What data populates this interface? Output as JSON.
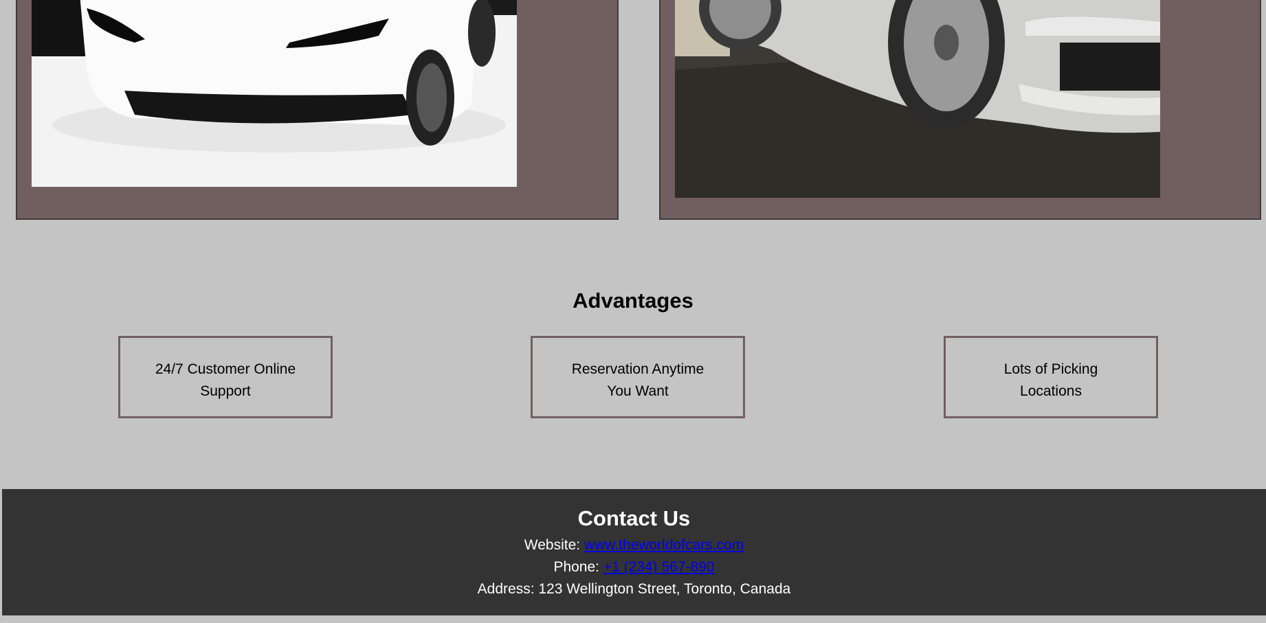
{
  "advantages": {
    "title": "Advantages",
    "items": [
      {
        "label": "24/7 Customer Online Support"
      },
      {
        "label": "Reservation Anytime You Want"
      },
      {
        "label": "Lots of Picking Locations"
      }
    ]
  },
  "contact": {
    "title": "Contact Us",
    "website_label": "Website:",
    "website_link": "www.theworldofcars.com",
    "phone_label": "Phone:",
    "phone_link": "+1 (234) 567-890",
    "address": "Address: 123 Wellington Street, Toronto, Canada"
  },
  "colors": {
    "page_bg": "#c4c4c4",
    "card_bg": "#715f5f",
    "footer_bg": "#333333",
    "link": "#0000ee"
  }
}
